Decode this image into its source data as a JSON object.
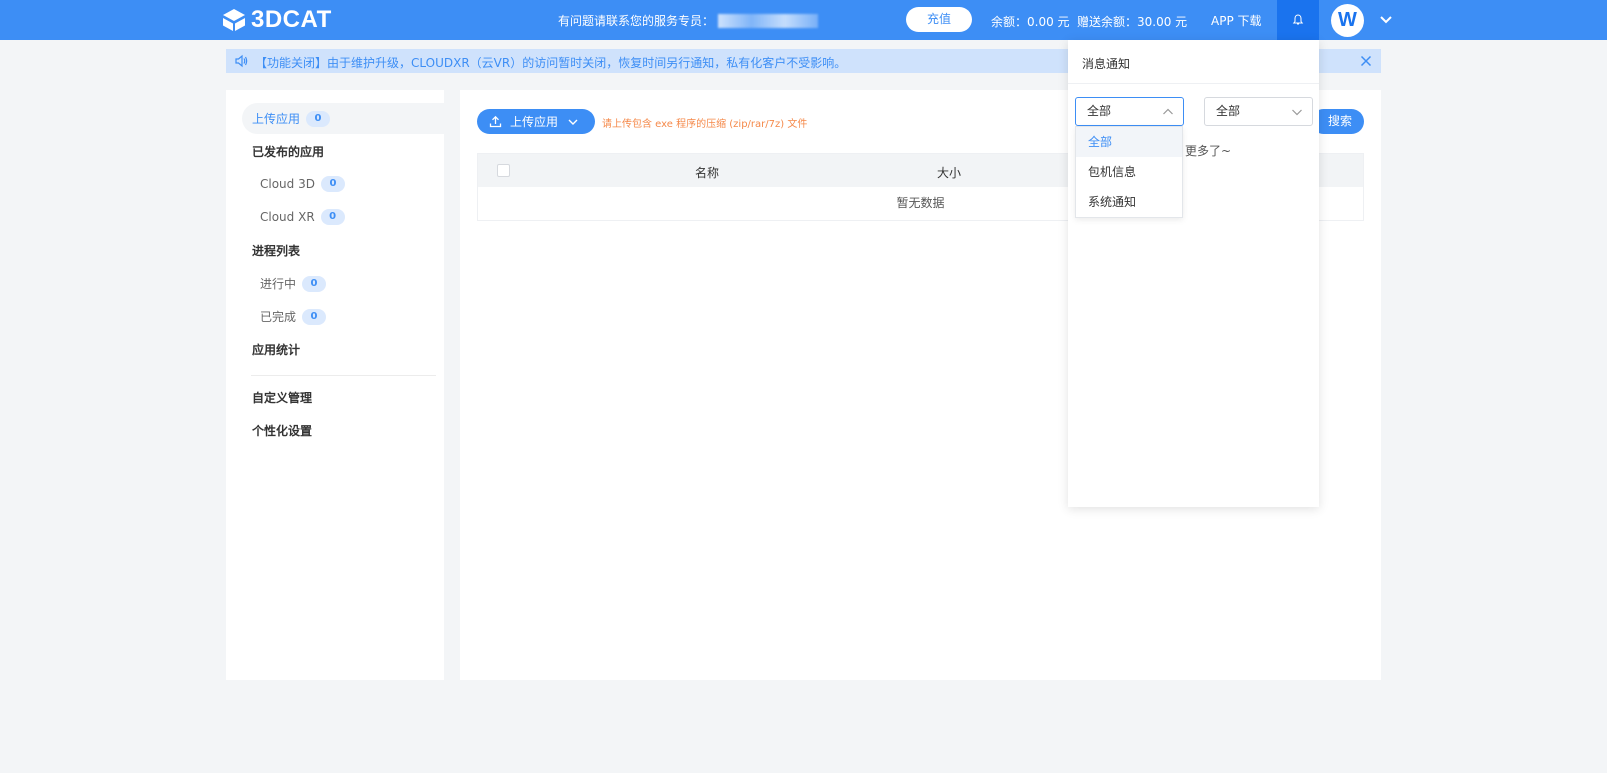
{
  "header": {
    "logo_text": "3DCAT",
    "contact_label": "有问题请联系您的服务专员：",
    "recharge_button": "充值",
    "balance": "余额：0.00 元",
    "gift_balance": "赠送余额：30.00 元",
    "app_download": "APP 下载",
    "avatar_letter": "W",
    "icons": {
      "bell": "bell-icon",
      "caret": "chevron-down-icon"
    }
  },
  "notice": {
    "text": "【功能关闭】由于维护升级，CLOUDXR（云VR）的访问暂时关闭，恢复时间另行通知，私有化客户不受影响。",
    "icons": {
      "left": "speaker-icon",
      "right": "close-icon"
    }
  },
  "sidebar": {
    "upload_app": {
      "label": "上传应用",
      "count": "0"
    },
    "published_title": "已发布的应用",
    "cloud3d": {
      "label": "Cloud 3D",
      "count": "0"
    },
    "cloudxr": {
      "label": "Cloud XR",
      "count": "0"
    },
    "process_title": "进程列表",
    "running": {
      "label": "进行中",
      "count": "0"
    },
    "finished": {
      "label": "已完成",
      "count": "0"
    },
    "stats": "应用统计",
    "custom": "自定义管理",
    "personal": "个性化设置"
  },
  "main": {
    "upload_button": "上传应用",
    "upload_hint": "请上传包含 exe 程序的压缩 (zip/rar/7z) 文件",
    "search_button_partial": "搜索",
    "table": {
      "columns": [
        "名称",
        "大小"
      ],
      "empty_text": "暂无数据"
    }
  },
  "notifications": {
    "title": "消息通知",
    "type_select": "全部",
    "status_select": "全部",
    "empty_partial": "更多了~",
    "dropdown_options": [
      "全部",
      "包机信息",
      "系统通知"
    ],
    "selected_option": "全部"
  },
  "colors": {
    "primary": "#3d8ef5",
    "primary_dark": "#1a73ee",
    "notice_bg": "#cfe2fc",
    "hint_orange": "#f5894a",
    "page_bg": "#f3f5f7"
  }
}
